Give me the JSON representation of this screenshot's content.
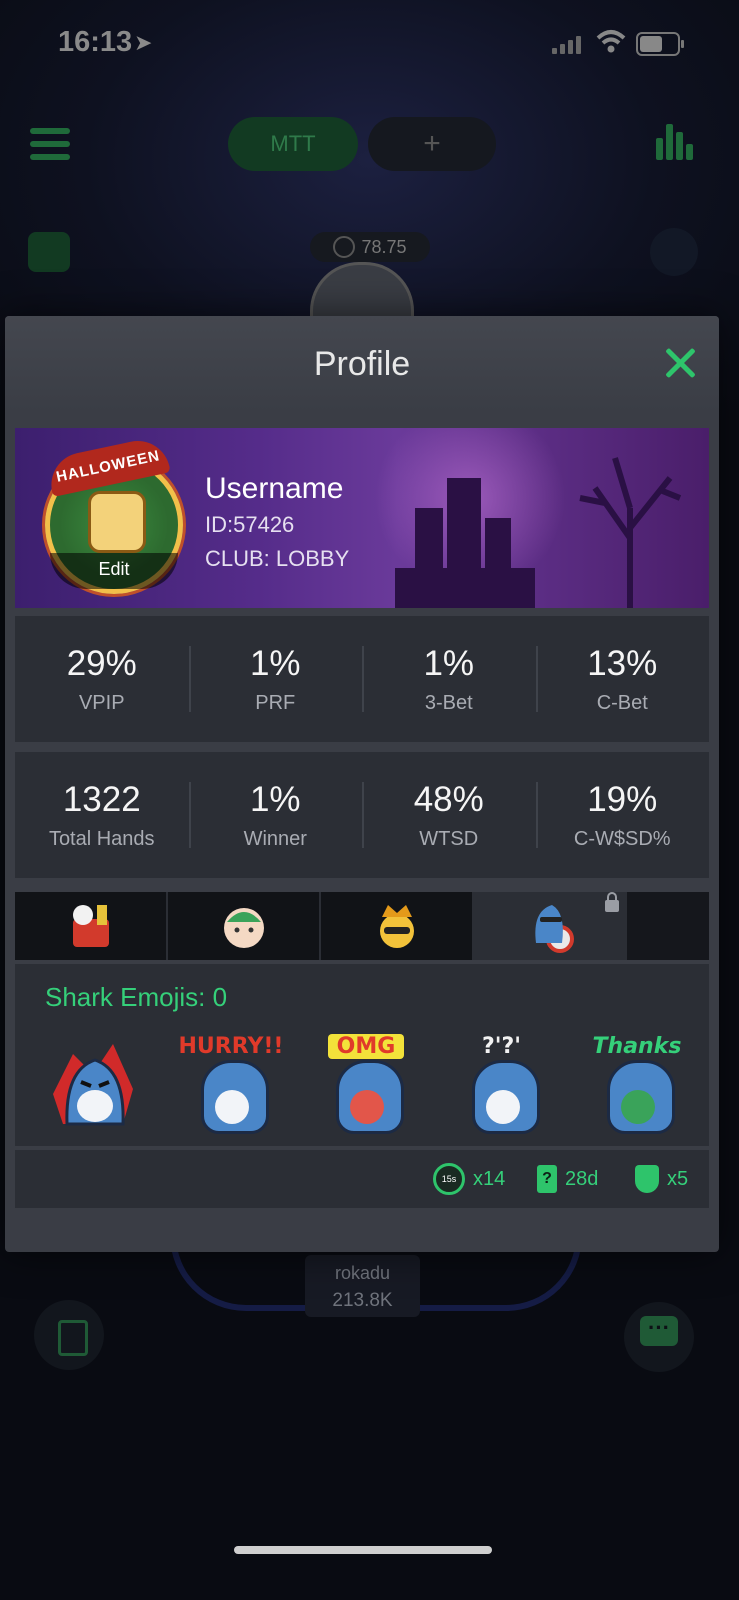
{
  "status_bar": {
    "time": "16:13"
  },
  "nav": {
    "mtt_label": "MTT",
    "plus_label": "+"
  },
  "table": {
    "coin_value": "78.75",
    "seat_name": "rokadu",
    "seat_chips": "213.8K"
  },
  "modal": {
    "title": "Profile",
    "profile": {
      "badge_text": "HALLOWEEN",
      "edit_label": "Edit",
      "username": "Username",
      "id": "ID:57426",
      "club": "CLUB: LOBBY"
    },
    "stats_row1": [
      {
        "value": "29%",
        "label": "VPIP"
      },
      {
        "value": "1%",
        "label": "PRF"
      },
      {
        "value": "1%",
        "label": "3-Bet"
      },
      {
        "value": "13%",
        "label": "C-Bet"
      }
    ],
    "stats_row2": [
      {
        "value": "1322",
        "label": "Total Hands"
      },
      {
        "value": "1%",
        "label": "Winner"
      },
      {
        "value": "48%",
        "label": "WTSD"
      },
      {
        "value": "19%",
        "label": "C-W$SD%"
      }
    ],
    "emoji_tabs": [
      "party-emoji-tab",
      "mochi-emoji-tab",
      "king-emoji-tab",
      "shark-emoji-tab"
    ],
    "emoji_section_title": "Shark Emojis: 0",
    "stickers": [
      {
        "name": "angry-shark-sticker",
        "text": ""
      },
      {
        "name": "hurry-shark-sticker",
        "text": "HURRY!!"
      },
      {
        "name": "omg-shark-sticker",
        "text": "OMG"
      },
      {
        "name": "confused-shark-sticker",
        "text": "?'?'"
      },
      {
        "name": "thanks-shark-sticker",
        "text": "Thanks"
      }
    ],
    "footer": {
      "timer_label": "15s",
      "timer_count": "x14",
      "card_days": "28d",
      "shield_count": "x5"
    }
  },
  "colors": {
    "accent": "#2ec46b",
    "panel": "#2b2e35",
    "modal": "#3a3d45",
    "banner": "#552c8a"
  }
}
